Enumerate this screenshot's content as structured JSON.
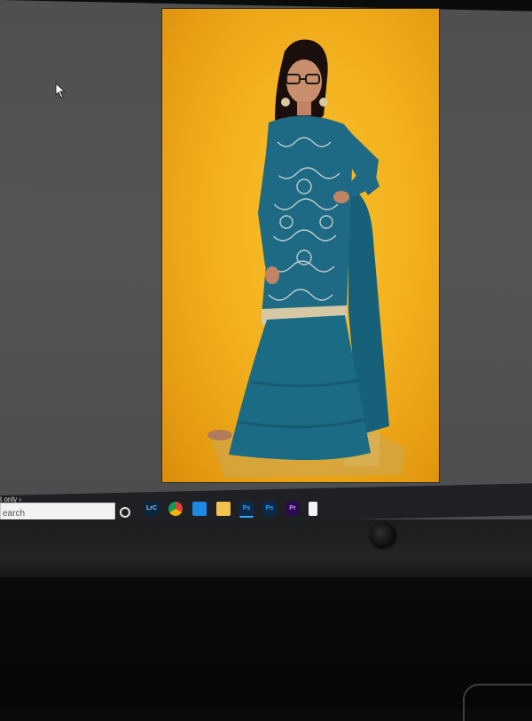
{
  "taskbar": {
    "hint_text": "t only  ›",
    "search_placeholder": "earch",
    "icons": [
      {
        "name": "cortana-circle-icon",
        "label": ""
      },
      {
        "name": "lightroom-classic-icon",
        "label": "LrC"
      },
      {
        "name": "chrome-icon",
        "label": ""
      },
      {
        "name": "mail-icon",
        "label": ""
      },
      {
        "name": "file-explorer-icon",
        "label": ""
      },
      {
        "name": "photoshop-icon",
        "label": "Ps"
      },
      {
        "name": "photoshop-second-icon",
        "label": "Ps"
      },
      {
        "name": "premiere-pro-icon",
        "label": "Pr"
      },
      {
        "name": "document-icon",
        "label": ""
      }
    ]
  },
  "colors": {
    "photo_background": "#f3b11e",
    "outfit_teal": "#1f6f86",
    "taskbar": "#1f2023",
    "ps_blue": "#0b2a4a",
    "pr_purple": "#2a0c4a"
  }
}
